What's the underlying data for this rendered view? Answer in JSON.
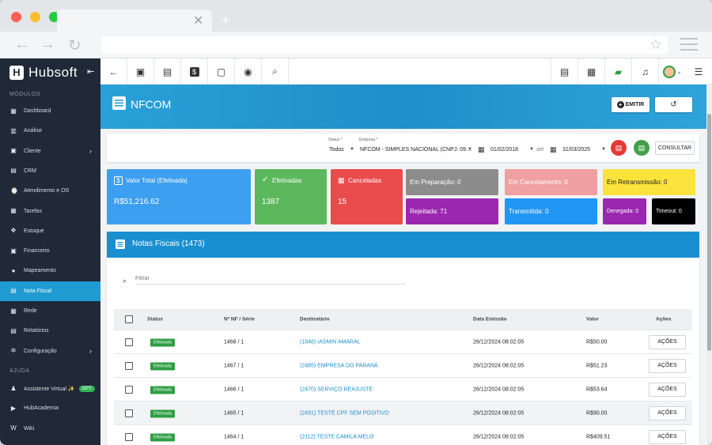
{
  "sidebar": {
    "logo_text": "Hubsoft",
    "logo_mark": "H",
    "section_modules": "MÓDULOS",
    "section_help": "AJUDA",
    "items": [
      {
        "label": "Dashboard",
        "icon": "dashboard-icon",
        "glyph": "▦"
      },
      {
        "label": "Análise",
        "icon": "chart-icon",
        "glyph": "▥"
      },
      {
        "label": "Cliente",
        "icon": "client-icon",
        "glyph": "▣",
        "chevron": "›"
      },
      {
        "label": "CRM",
        "icon": "crm-icon",
        "glyph": "▤"
      },
      {
        "label": "Atendimento e OS",
        "icon": "service-icon",
        "glyph": "⌚"
      },
      {
        "label": "Tarefas",
        "icon": "tasks-icon",
        "glyph": "▦"
      },
      {
        "label": "Estoque",
        "icon": "stock-icon",
        "glyph": "✥"
      },
      {
        "label": "Financeiro",
        "icon": "finance-icon",
        "glyph": "▣"
      },
      {
        "label": "Mapeamento",
        "icon": "map-pin-icon",
        "glyph": "●"
      },
      {
        "label": "Nota Fiscal",
        "icon": "invoice-icon",
        "glyph": "▤"
      },
      {
        "label": "Rede",
        "icon": "network-icon",
        "glyph": "▦"
      },
      {
        "label": "Relatórios",
        "icon": "report-icon",
        "glyph": "▤"
      },
      {
        "label": "Configuração",
        "icon": "gear-icon",
        "glyph": "✲",
        "chevron": "›"
      }
    ],
    "help_items": [
      {
        "label": "Assistente Virtual ✨",
        "icon": "android-icon",
        "glyph": "♟",
        "badge": "GPT"
      },
      {
        "label": "HubAcademia",
        "icon": "youtube-icon",
        "glyph": "▶"
      },
      {
        "label": "Wiki",
        "icon": "wiki-icon",
        "glyph": "W"
      }
    ]
  },
  "header": {
    "title": "NFCOM",
    "emitir_label": "EMITIR"
  },
  "filter": {
    "status_label": "Status *",
    "status_value": "Todos",
    "empresa_label": "Empresa *",
    "empresa_value": "NFCOM - SIMPLES NACIONAL (CNPJ: 09....",
    "date_from": "01/02/2018",
    "date_sep": "até",
    "date_to": "31/03/2025",
    "consultar_label": "CONSULTAR"
  },
  "stats": {
    "total_label": "Valor Total (Efetivada)",
    "total_value": "R$51,216.62",
    "efetivadas_label": "Efetivadas",
    "efetivadas_value": "1387",
    "canceladas_label": "Canceladas",
    "canceladas_value": "15",
    "em_preparacao": "Em Preparação: 0",
    "em_cancelamento": "Em Cancelamento: 0",
    "em_retransmissao": "Em Retransmissão: 0",
    "rejeitada": "Rejeitada: 71",
    "transmitida": "Transmitida: 0",
    "denegada": "Denegada: 0",
    "timeout": "Timeout: 0"
  },
  "table": {
    "title": "Notas Fiscais (1473)",
    "search_placeholder": "Filtrar",
    "columns": {
      "status": "Status",
      "nf": "Nº NF / Série",
      "dest": "Destinatário",
      "data": "Data Emissão",
      "valor": "Valor",
      "acoes": "Ações"
    },
    "rows": [
      {
        "status": "Efetivada",
        "nf": "1468 / 1",
        "dest": "(1848) IASMIN AMARAL",
        "data": "26/12/2024 08:02:05",
        "valor": "R$50.00",
        "acao": "AÇÕES"
      },
      {
        "status": "Efetivada",
        "nf": "1467 / 1",
        "dest": "(2485) EMPRESA DO PARANÁ",
        "data": "26/12/2024 08:02:05",
        "valor": "R$51.23",
        "acao": "AÇÕES"
      },
      {
        "status": "Efetivada",
        "nf": "1466 / 1",
        "dest": "(2470) SERVIÇO REAJUSTE",
        "data": "26/12/2024 08:02:05",
        "valor": "R$53.64",
        "acao": "AÇÕES"
      },
      {
        "status": "Efetivada",
        "nf": "1465 / 1",
        "dest": "(2431) TESTE CPF SEM POSITIVO",
        "data": "26/12/2024 08:02:05",
        "valor": "R$90.00",
        "acao": "AÇÕES"
      },
      {
        "status": "Efetivada",
        "nf": "1464 / 1",
        "dest": "(2112) TESTE CAMILA MELO",
        "data": "26/12/2024 08:02:05",
        "valor": "R$409.51",
        "acao": "AÇÕES"
      }
    ]
  },
  "colors": {
    "sidebar_bg": "#1f2937",
    "accent": "#1f9bd1",
    "card_total": "#3d9ff0",
    "card_efetivadas": "#5cb85c",
    "card_canceladas": "#ea4b4b",
    "badge_efetivada": "#2e9e44"
  }
}
